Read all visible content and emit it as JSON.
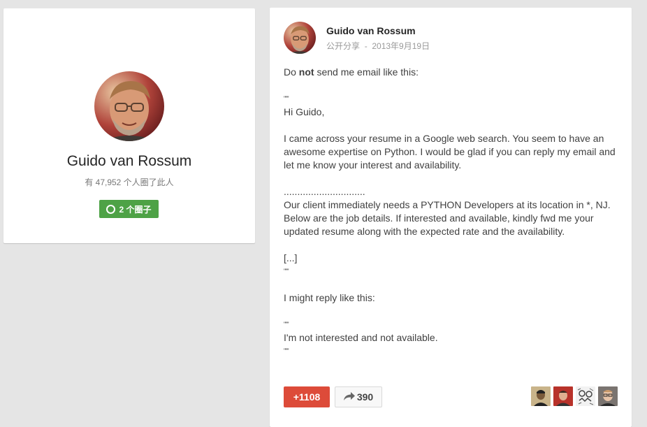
{
  "profile": {
    "name": "Guido van Rossum",
    "followers_text": "有 47,952 个人圈了此人",
    "circles_button_label": "2 个圈子"
  },
  "post": {
    "author_name": "Guido van Rossum",
    "visibility": "公开分享",
    "separator": "-",
    "date": "2013年9月19日",
    "body": {
      "intro_prefix": "Do ",
      "intro_bold": "not",
      "intro_suffix": " send me email like this:",
      "quote_mark": "\"\"\"",
      "greeting": "Hi Guido,",
      "paragraph1": "I came across your resume in a Google web search. You seem to have an awesome expertise on Python. I would be glad if you can reply my email and let me know your interest and availability.",
      "dots": "..............................",
      "paragraph2": "Our client immediately needs a PYTHON Developers at its location in *, NJ. Below are the job details. If interested and available, kindly fwd me your updated resume along with the expected rate and the availability.",
      "ellipsis": "[...]",
      "reply_intro": "I might reply like this:",
      "reply": "I'm not interested and not available."
    },
    "plus_one_label": "+1108",
    "share_count": "390",
    "plusoner_count": 4
  },
  "colors": {
    "page_background": "#e5e5e5",
    "plus_one_red": "#dd4b39",
    "circles_green": "#4ea246"
  },
  "icons": {
    "share": "share-arrow-icon",
    "circle": "circle-icon"
  }
}
